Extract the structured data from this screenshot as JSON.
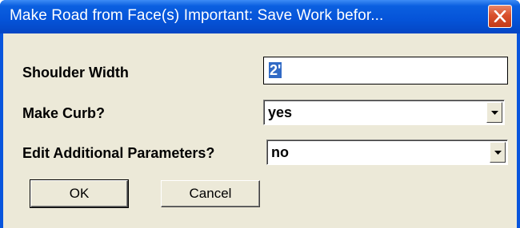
{
  "window": {
    "title": "Make Road from Face(s)   Important: Save Work befor..."
  },
  "form": {
    "shoulder_width": {
      "label": "Shoulder Width",
      "value": "2'"
    },
    "make_curb": {
      "label": "Make Curb?",
      "value": "yes"
    },
    "edit_additional": {
      "label": "Edit Additional Parameters?",
      "value": "no"
    }
  },
  "buttons": {
    "ok": "OK",
    "cancel": "Cancel"
  },
  "icons": {
    "close": "close-icon",
    "dropdown": "chevron-down-icon"
  },
  "colors": {
    "titlebar": "#0553d8",
    "close_button": "#d9502c",
    "dialog_face": "#ece9d8",
    "selection": "#316ac5"
  }
}
